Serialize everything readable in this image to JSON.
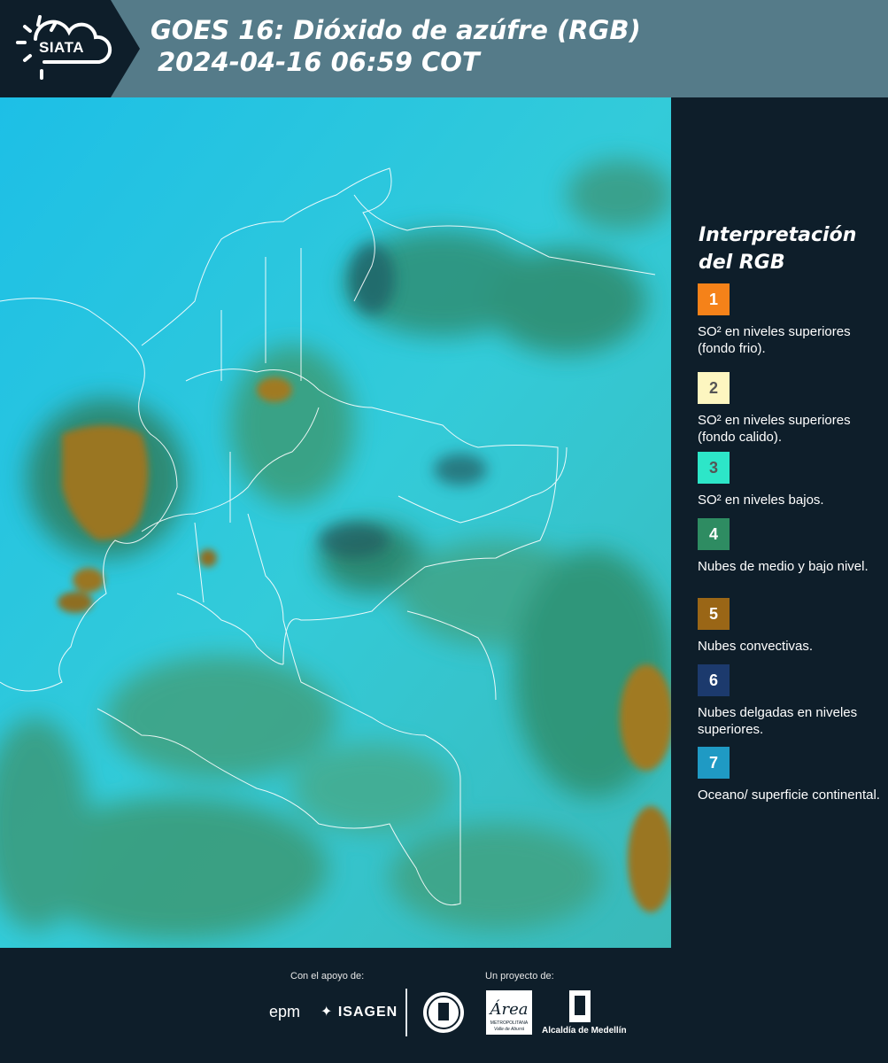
{
  "header": {
    "logo_text": "SIATA",
    "title_line1": "GOES 16: Dióxido de azúfre (RGB)",
    "title_line2": "2024-04-16 06:59 COT"
  },
  "legend": {
    "title_line1": "Interpretación",
    "title_line2": "del RGB",
    "items": [
      {
        "number": "1",
        "color": "#f58219",
        "text": "SO² en niveles superiores (fondo frio)."
      },
      {
        "number": "2",
        "color": "#fdf6c0",
        "text": "SO² en niveles superiores (fondo calido)."
      },
      {
        "number": "3",
        "color": "#2de6c8",
        "text": "SO² en niveles bajos."
      },
      {
        "number": "4",
        "color": "#2e8c62",
        "text": "Nubes de medio y bajo nivel."
      },
      {
        "number": "5",
        "color": "#9a6616",
        "text": "Nubes convectivas."
      },
      {
        "number": "6",
        "color": "#1c3a6d",
        "text": "Nubes delgadas en niveles superiores."
      },
      {
        "number": "7",
        "color": "#1f9ac4",
        "text": "Oceano/ superficie continental."
      }
    ]
  },
  "footer": {
    "support_label": "Con el apoyo de:",
    "project_label": "Un proyecto de:",
    "sponsor1": "epm",
    "sponsor2": "ISAGEN",
    "partner_area": "Área",
    "partner_area_sub": "METROPOLITANA",
    "partner_area_sub2": "Valle de Aburrá",
    "partner_alcaldia": "Alcaldía de Medellín"
  }
}
